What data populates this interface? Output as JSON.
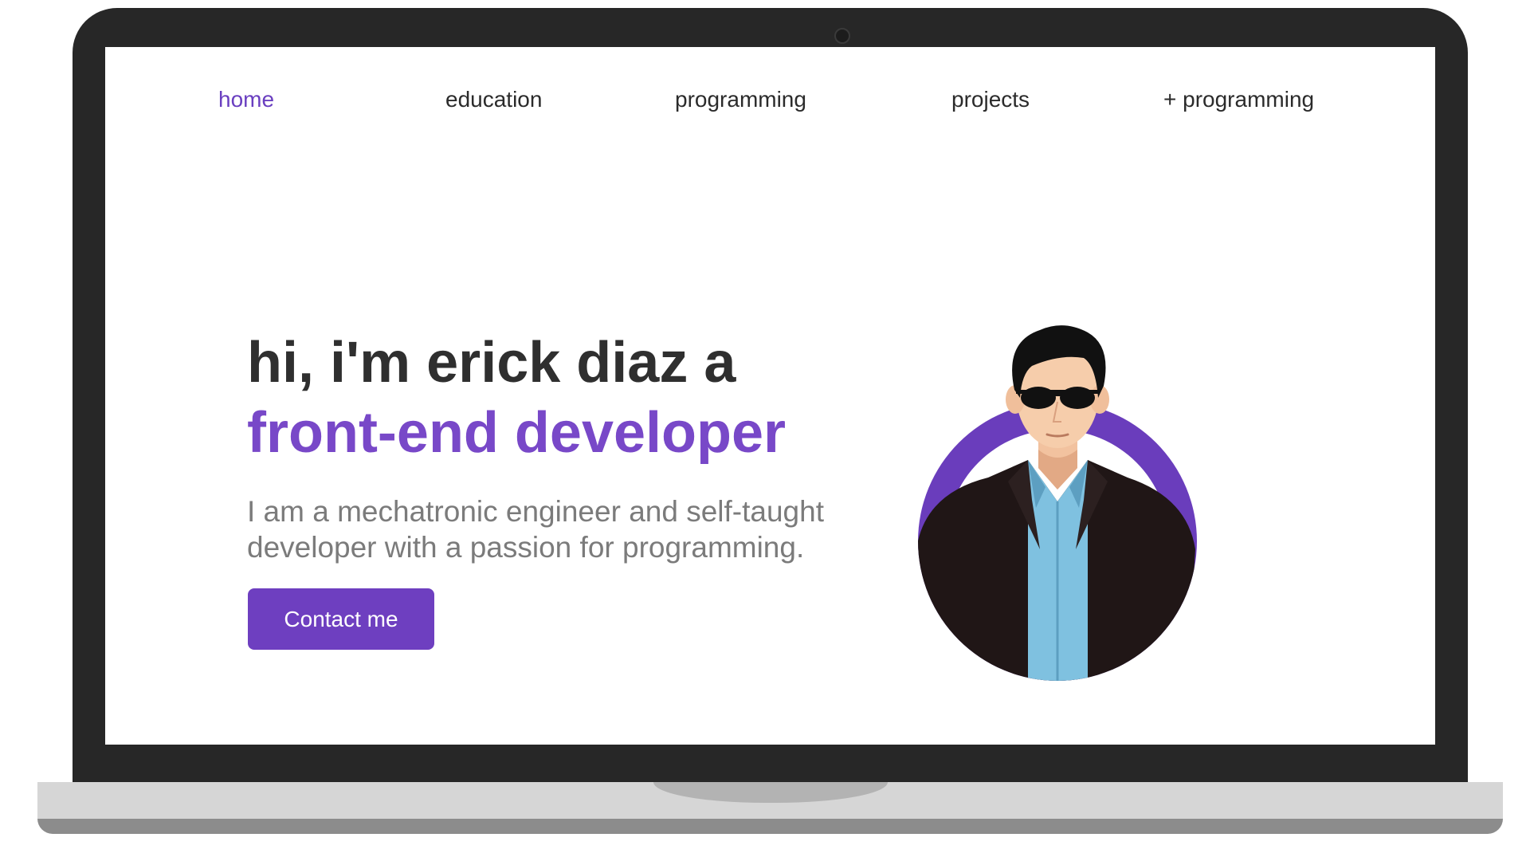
{
  "nav": {
    "items": [
      {
        "label": "home",
        "active": true
      },
      {
        "label": "education",
        "active": false
      },
      {
        "label": "programming",
        "active": false
      },
      {
        "label": "projects",
        "active": false
      },
      {
        "label": "+ programming",
        "active": false
      }
    ]
  },
  "hero": {
    "title": "hi, i'm erick diaz a",
    "subtitle": "front-end developer",
    "description": "I am a mechatronic engineer and self-taught developer with a passion for programming.",
    "contact_label": "Contact me"
  },
  "colors": {
    "accent": "#6e3fc0",
    "subtitle": "#7848c8",
    "title": "#2f2f2f",
    "description": "#7b7b7b",
    "bezel": "#272727"
  },
  "icons": {
    "avatar": "developer-avatar-illustration"
  }
}
